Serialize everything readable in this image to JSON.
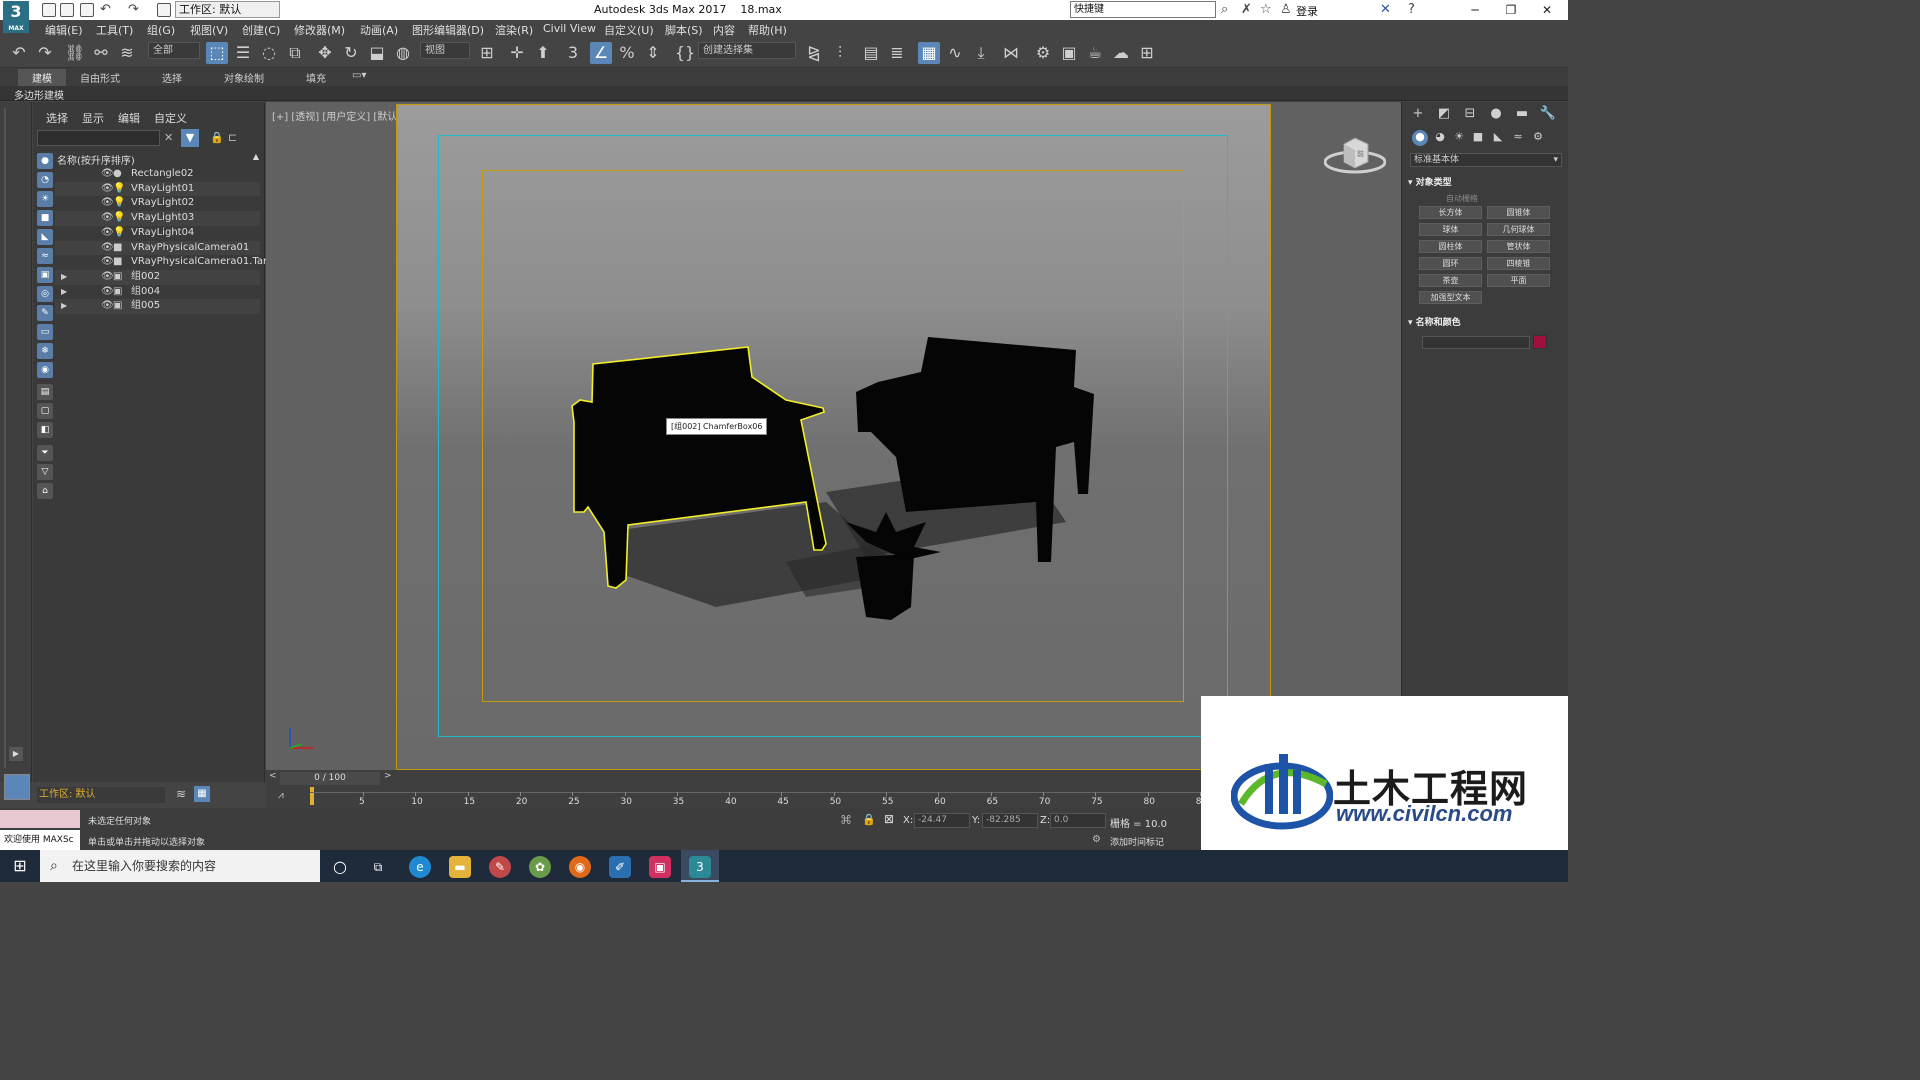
{
  "title_bar": {
    "logo_text": "3",
    "logo_sub": "MAX",
    "workspace_label": "工作区: 默认",
    "app_title": "Autodesk 3ds Max 2017",
    "file_name": "18.max",
    "search_value": "快捷键",
    "login_label": "登录",
    "minimize": "─",
    "restore": "❐",
    "close": "✕"
  },
  "menu": [
    "编辑(E)",
    "工具(T)",
    "组(G)",
    "视图(V)",
    "创建(C)",
    "修改器(M)",
    "动画(A)",
    "图形编辑器(D)",
    "渲染(R)",
    "Civil View",
    "自定义(U)",
    "脚本(S)",
    "内容",
    "帮助(H)"
  ],
  "toolbar": {
    "selection_filter": "全部",
    "ref_coord": "视图",
    "named_selection": "创建选择集"
  },
  "ribbon": {
    "tabs": [
      "建模",
      "自由形式",
      "选择",
      "对象绘制",
      "填充"
    ],
    "active_tab": "建模",
    "subpanel": "多边形建模"
  },
  "scene_explorer": {
    "tabs": [
      "选择",
      "显示",
      "编辑",
      "自定义"
    ],
    "column_header": "名称(按升序排序)",
    "objects": [
      {
        "name": "Rectangle02",
        "type": "●",
        "expand": ""
      },
      {
        "name": "VRayLight01",
        "type": "💡",
        "expand": ""
      },
      {
        "name": "VRayLight02",
        "type": "💡",
        "expand": ""
      },
      {
        "name": "VRayLight03",
        "type": "💡",
        "expand": ""
      },
      {
        "name": "VRayLight04",
        "type": "💡",
        "expand": ""
      },
      {
        "name": "VRayPhysicalCamera01",
        "type": "■",
        "expand": ""
      },
      {
        "name": "VRayPhysicalCamera01.Target",
        "type": "■",
        "expand": ""
      },
      {
        "name": "组002",
        "type": "▣",
        "expand": "▶"
      },
      {
        "name": "组004",
        "type": "▣",
        "expand": "▶"
      },
      {
        "name": "组005",
        "type": "▣",
        "expand": "▶"
      }
    ],
    "workspace_bottom": "工作区: 默认"
  },
  "viewport": {
    "label": "[+] [透视] [用户定义] [默认明暗处理]",
    "tooltip": "[组002] ChamferBox06",
    "viewcube_label": "前"
  },
  "command_panel": {
    "dropdown": "标准基本体",
    "rollout_object_type": "对象类型",
    "autogrid": "自动栅格",
    "buttons": [
      "长方体",
      "圆锥体",
      "球体",
      "几何球体",
      "圆柱体",
      "管状体",
      "圆环",
      "四棱锥",
      "茶壶",
      "平面",
      "加强型文本"
    ],
    "rollout_name_color": "名称和颜色",
    "object_color": "#a0103c"
  },
  "timeline": {
    "frame_counter": "0 / 100",
    "ticks": [
      "5",
      "10",
      "15",
      "20",
      "25",
      "30",
      "35",
      "40",
      "45",
      "50",
      "55",
      "60",
      "65",
      "70",
      "75",
      "80",
      "8"
    ]
  },
  "status": {
    "maxscript": "欢迎使用 MAXSc",
    "message_1": "未选定任何对象",
    "message_2": "单击或单击并拖动以选择对象",
    "x_label": "X:",
    "x_value": "-24.47",
    "y_label": "Y:",
    "y_value": "-82.285",
    "z_label": "Z:",
    "z_value": "0.0",
    "grid": "栅格 = 10.0",
    "add_time_tag": "添加时间标记"
  },
  "watermark": {
    "cn_text": "土木工程网",
    "url": "www.civilcn.com"
  },
  "taskbar": {
    "search_placeholder": "在这里输入你要搜索的内容"
  }
}
